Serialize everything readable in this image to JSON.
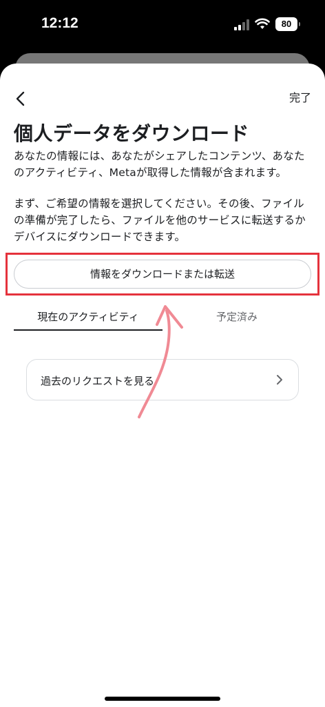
{
  "status_bar": {
    "time": "12:12",
    "battery": "80"
  },
  "header": {
    "done_label": "完了"
  },
  "page": {
    "title": "個人データをダウンロード",
    "description_1": "あなたの情報には、あなたがシェアしたコンテンツ、あなたのアクティビティ、Metaが取得した情報が含まれます。",
    "description_2": "まず、ご希望の情報を選択してください。その後、ファイルの準備が完了したら、ファイルを他のサービスに転送するかデバイスにダウンロードできます。"
  },
  "primary_button": {
    "label": "情報をダウンロードまたは転送"
  },
  "tabs": [
    {
      "label": "現在のアクティビティ",
      "active": true
    },
    {
      "label": "予定済み",
      "active": false
    }
  ],
  "past_requests": {
    "label": "過去のリクエストを見る"
  },
  "colors": {
    "highlight": "#e5323c",
    "annotation_arrow": "#f08a94",
    "text": "#1c1e21",
    "muted": "#65676b"
  },
  "icons": [
    "back-chevron-icon",
    "chevron-right-icon",
    "signal-icon",
    "wifi-icon",
    "battery-icon"
  ]
}
